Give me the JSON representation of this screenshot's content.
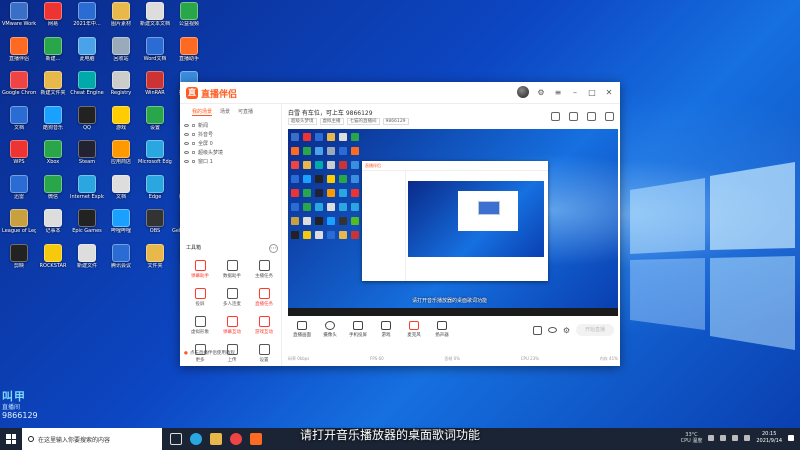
{
  "desktop": {
    "icons": [
      {
        "label": "VMware Workstation",
        "color": "#3a6fc8"
      },
      {
        "label": "网易",
        "color": "#e33"
      },
      {
        "label": "2021年中...",
        "color": "#2b6cd4"
      },
      {
        "label": "图片素材",
        "color": "#e9b84a"
      },
      {
        "label": "新建文本文档",
        "color": "#ddd"
      },
      {
        "label": "公益视频",
        "color": "#2aa64a"
      },
      {
        "label": "直播伴侣",
        "color": "#ff6a22"
      },
      {
        "label": "新建...",
        "color": "#2aa64a"
      },
      {
        "label": "此电脑",
        "color": "#4aa3e8"
      },
      {
        "label": "回收站",
        "color": "#9ab"
      },
      {
        "label": "Word文档",
        "color": "#2b6cd4"
      },
      {
        "label": "直播助手",
        "color": "#ff6a22"
      },
      {
        "label": "Google Chrome",
        "color": "#e44"
      },
      {
        "label": "新建文件夹",
        "color": "#e9b84a"
      },
      {
        "label": "Cheat Engine",
        "color": "#0aa"
      },
      {
        "label": "Registry",
        "color": "#ccc"
      },
      {
        "label": "WinRAR",
        "color": "#c33"
      },
      {
        "label": "控制面板",
        "color": "#3a8de0"
      },
      {
        "label": "文档",
        "color": "#2b6cd4"
      },
      {
        "label": "酷狗音乐",
        "color": "#1aa0ff"
      },
      {
        "label": "QQ",
        "color": "#222"
      },
      {
        "label": "游戏",
        "color": "#ffcc00"
      },
      {
        "label": "设置",
        "color": "#2aa64a"
      },
      {
        "label": "网络",
        "color": "#3a8de0"
      },
      {
        "label": "WPS",
        "color": "#e33"
      },
      {
        "label": "Xbox",
        "color": "#2aa64a"
      },
      {
        "label": "Steam",
        "color": "#223"
      },
      {
        "label": "应用商店",
        "color": "#f90"
      },
      {
        "label": "Microsoft Edge",
        "color": "#2aa6e0"
      },
      {
        "label": "Office",
        "color": "#e33"
      },
      {
        "label": "迅雷",
        "color": "#2b6cd4"
      },
      {
        "label": "微信",
        "color": "#2aa64a"
      },
      {
        "label": "Internet Explorer",
        "color": "#2aa6e0"
      },
      {
        "label": "文档",
        "color": "#ddd"
      },
      {
        "label": "Edge",
        "color": "#2aa6e0"
      },
      {
        "label": "腾讯视频",
        "color": "#2aa6e0"
      },
      {
        "label": "League of Legends",
        "color": "#c9a040"
      },
      {
        "label": "记事本",
        "color": "#ddd"
      },
      {
        "label": "Epic Games",
        "color": "#222"
      },
      {
        "label": "哔哩哔哩",
        "color": "#1aa0ff"
      },
      {
        "label": "OBS",
        "color": "#333"
      },
      {
        "label": "GeForce Experience",
        "color": "#5b2"
      },
      {
        "label": "剪映",
        "color": "#222"
      },
      {
        "label": "ROCKSTAR",
        "color": "#f7c90c"
      },
      {
        "label": "新建文件",
        "color": "#ddd"
      },
      {
        "label": "腾讯会议",
        "color": "#2b6cd4"
      },
      {
        "label": "文件夹",
        "color": "#e9b84a"
      },
      {
        "label": "PDF",
        "color": "#c33"
      }
    ]
  },
  "app": {
    "brand": "直播伴侣",
    "left_tabs": [
      "我的场景",
      "场景",
      "可直播"
    ],
    "scenes": [
      "新闻",
      "抖音号",
      "全屏 0",
      "超级头梦境",
      "窗口 1"
    ],
    "tools_header": "工具箱",
    "tools": [
      {
        "label": "弹幕助手",
        "red": true,
        "color": "#ff3b30"
      },
      {
        "label": "数据助手",
        "red": false,
        "color": "#555"
      },
      {
        "label": "主播任务",
        "red": false,
        "color": "#555"
      },
      {
        "label": "投屏",
        "red": false,
        "color": "#ff3b30"
      },
      {
        "label": "多人连麦",
        "red": false,
        "color": "#555"
      },
      {
        "label": "直播任务",
        "red": true,
        "color": "#ff3b30"
      },
      {
        "label": "虚拟形象",
        "red": false,
        "color": "#555"
      },
      {
        "label": "弹幕互动",
        "red": true,
        "color": "#ff3b30"
      },
      {
        "label": "游戏互动",
        "red": true,
        "color": "#ff3b30"
      },
      {
        "label": "更多",
        "red": false,
        "color": "#555"
      },
      {
        "label": "上传",
        "red": false,
        "color": "#555"
      },
      {
        "label": "设置",
        "red": false,
        "color": "#555"
      }
    ],
    "footer_text": "点击直播伴侣使用教程",
    "room_title": "白雪 有车位，可上车",
    "room_id": "9866129",
    "room_chips": [
      "超级头梦境",
      "虚拟主播",
      "七猫的直播间",
      "9866129"
    ],
    "preview_caption": "请打开音乐播放器的桌面歌词功能",
    "controls": [
      "直播画面",
      "摄像头",
      "手机投屏",
      "游戏",
      "麦克风",
      "扬声器"
    ],
    "go_live": "开始直播",
    "status": [
      "码率 0kbps",
      "FPS 60",
      "丢帧 0%",
      "CPU 23%",
      "内存 41%"
    ]
  },
  "watermark": {
    "logo": "叫甲",
    "sub": "直播间",
    "number": "9866129"
  },
  "subtitle": "请打开音乐播放器的桌面歌词功能",
  "taskbar": {
    "search_placeholder": "在这里输入你要搜索的内容",
    "weather": "33°C",
    "weather_sub": "CPU 温度",
    "time": "20:15",
    "date": "2021/9/14"
  }
}
